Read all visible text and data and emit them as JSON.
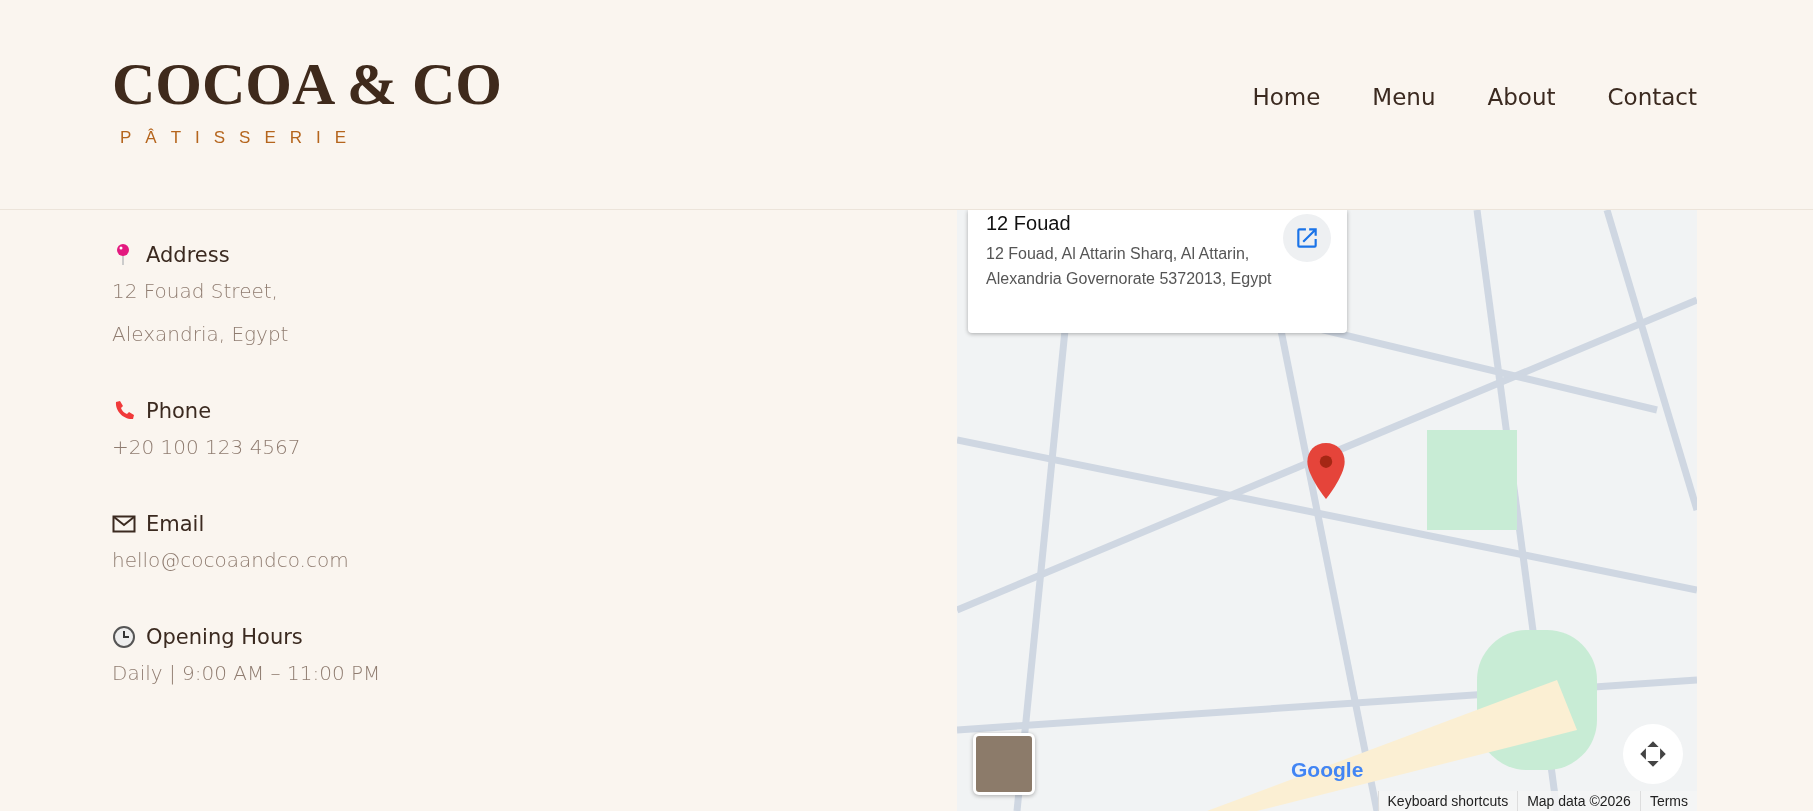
{
  "header": {
    "logo": "COCOA & CO",
    "tagline": "PÂTISSERIE",
    "nav": [
      {
        "label": "Home"
      },
      {
        "label": "Menu"
      },
      {
        "label": "About"
      },
      {
        "label": "Contact"
      }
    ]
  },
  "contact": [
    {
      "kind": "pin",
      "heading": "Address",
      "lines": [
        "12 Fouad Street,",
        "Alexandria, Egypt"
      ]
    },
    {
      "kind": "phone",
      "heading": "Phone",
      "lines": [
        "+20 100 123 4567"
      ]
    },
    {
      "kind": "mail",
      "heading": "Email",
      "lines": [
        "hello@cocoaandco.com"
      ]
    },
    {
      "kind": "clock",
      "heading": "Opening Hours",
      "lines": [
        "Daily | 9:00 AM – 11:00 PM"
      ]
    }
  ],
  "map": {
    "place_title": "12 Fouad",
    "place_address": "12 Fouad, Al Attarin Sharq, Al Attarin, Alexandria Governorate 5372013, Egypt",
    "logo": "Google",
    "attribution": [
      "Keyboard shortcuts",
      "Map data ©2026",
      "Terms"
    ]
  }
}
